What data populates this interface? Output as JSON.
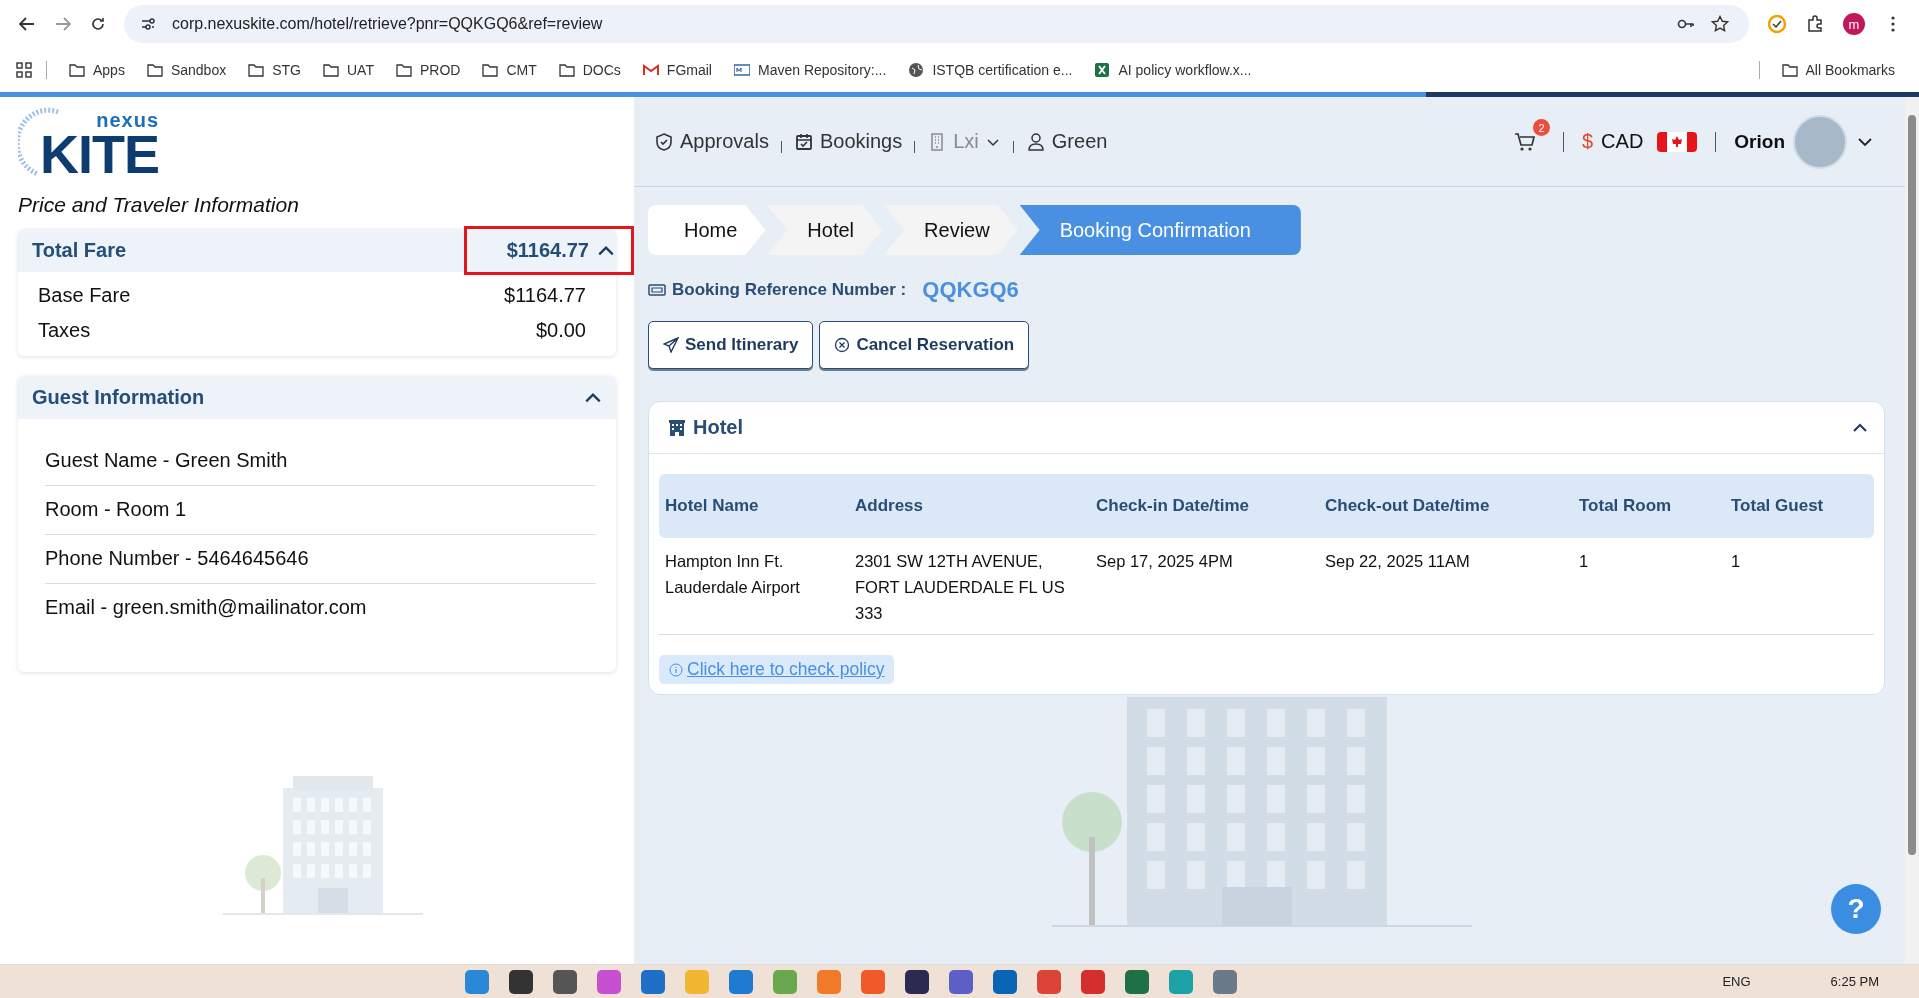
{
  "browser": {
    "url": "corp.nexuskite.com/hotel/retrieve?pnr=QQKGQ6&ref=review",
    "profile_initial": "m",
    "bookmarks": [
      {
        "label": "Apps",
        "kind": "folder"
      },
      {
        "label": "Sandbox",
        "kind": "folder"
      },
      {
        "label": "STG",
        "kind": "folder"
      },
      {
        "label": "UAT",
        "kind": "folder"
      },
      {
        "label": "PROD",
        "kind": "folder"
      },
      {
        "label": "CMT",
        "kind": "folder"
      },
      {
        "label": "DOCs",
        "kind": "folder"
      },
      {
        "label": "FGmail",
        "kind": "gmail"
      },
      {
        "label": "Maven Repository:...",
        "kind": "maven"
      },
      {
        "label": "ISTQB certification e...",
        "kind": "globe"
      },
      {
        "label": "AI policy workflow.x...",
        "kind": "excel"
      }
    ],
    "all_bookmarks": "All Bookmarks"
  },
  "sidebar": {
    "logo_small": "nexus",
    "logo_large": "KITE",
    "subtitle": "Price and Traveler Information",
    "total_fare": {
      "label": "Total Fare",
      "amount": "$1164.77",
      "expanded": true,
      "highlighted": true
    },
    "fare_rows": [
      {
        "label": "Base Fare",
        "value": "$1164.77"
      },
      {
        "label": "Taxes",
        "value": "$0.00"
      }
    ],
    "guest_info": {
      "title": "Guest Information",
      "expanded": true,
      "rows": [
        "Guest Name - Green Smith",
        "Room - Room 1",
        "Phone Number - 5464645646",
        "Email - green.smith@mailinator.com"
      ]
    }
  },
  "header": {
    "nav": [
      {
        "label": "Approvals",
        "kind": "shield",
        "muted": false
      },
      {
        "label": "Bookings",
        "kind": "calendar",
        "muted": false
      },
      {
        "label": "Lxi",
        "kind": "building",
        "muted": true
      },
      {
        "label": "Green",
        "kind": "user",
        "muted": false
      }
    ],
    "cart_count": "2",
    "currency_symbol": "$",
    "currency": "CAD",
    "user": "Orion"
  },
  "breadcrumb": [
    {
      "label": "Home",
      "selected": false
    },
    {
      "label": "Hotel",
      "selected": false
    },
    {
      "label": "Review",
      "selected": false
    },
    {
      "label": "Booking Confirmation",
      "selected": true
    }
  ],
  "booking_ref": {
    "label": "Booking Reference Number :",
    "value": "QQKGQ6"
  },
  "actions": [
    {
      "label": "Send Itinerary",
      "kind": "send"
    },
    {
      "label": "Cancel Reservation",
      "kind": "cancel"
    }
  ],
  "hotel_card": {
    "title": "Hotel",
    "expanded": true,
    "columns": [
      "Hotel Name",
      "Address",
      "Check-in Date/time",
      "Check-out Date/time",
      "Total Room",
      "Total Guest"
    ],
    "rows": [
      [
        "Hampton Inn Ft. Lauderdale Airport",
        "2301 SW 12TH AVENUE, FORT LAUDERDALE FL US 333",
        "Sep 17, 2025 4PM",
        "Sep 22, 2025 11AM",
        "1",
        "1"
      ]
    ],
    "policy_link": "Click here to check policy"
  },
  "help": "?",
  "taskbar": {
    "language": "ENG",
    "time": "6:25 PM"
  }
}
